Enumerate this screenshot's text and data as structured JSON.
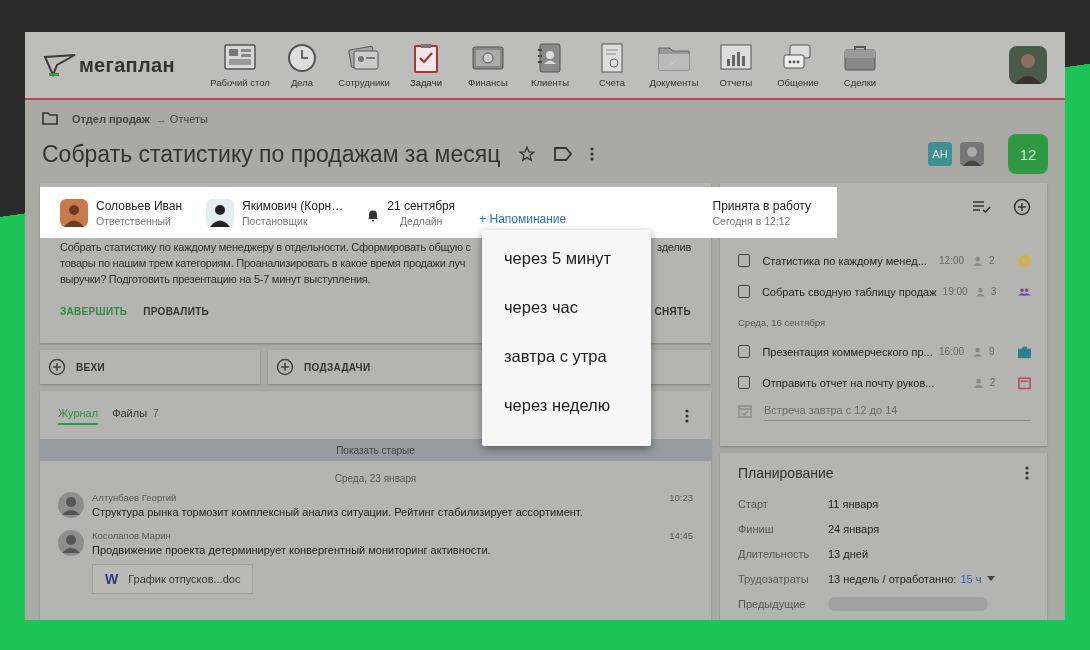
{
  "header": {
    "logo": "мегаплан",
    "nav": [
      {
        "label": "Рабочий стол",
        "selected": false
      },
      {
        "label": "Дела",
        "selected": false
      },
      {
        "label": "Сотрудники",
        "selected": false
      },
      {
        "label": "Задачи",
        "selected": true
      },
      {
        "label": "Финансы",
        "selected": false
      },
      {
        "label": "Клиенты",
        "selected": false
      },
      {
        "label": "Счета",
        "selected": false
      },
      {
        "label": "Документы",
        "selected": false
      },
      {
        "label": "Отчеты",
        "selected": false
      },
      {
        "label": "Общение",
        "selected": false
      },
      {
        "label": "Сделки",
        "selected": false
      }
    ]
  },
  "breadcrumb": {
    "section": "Отдел продаж",
    "current": "→ Отчеты"
  },
  "task": {
    "title": "Собрать статистику по продажам за месяц",
    "watchers_initials": "АН",
    "counter": "12",
    "participants": [
      {
        "name": "Соловьев Иван",
        "role": "Ответственный"
      },
      {
        "name": "Якимович (Корн…",
        "role": "Постановщик"
      }
    ],
    "deadline": {
      "date": "21 сентября",
      "label": "Дедлайн"
    },
    "reminder_link": "+ Напоминание",
    "status": {
      "text": "Принята в работу",
      "time": "Сегодня в 12:12"
    },
    "description_lines": [
      {
        "left": "Собрать статистику по каждому менеджеру в отдельности. Сформировать общую с",
        "right": "зделив"
      },
      {
        "left": "товары по нашим трем категориям. Проанализировать в какое время продажи луч"
      },
      {
        "left": "выручки? Подготовить презентацию на 5-7 минут выступления."
      }
    ],
    "actions": [
      {
        "label": "ЗАВЕРШИТЬ",
        "kind": "primary"
      },
      {
        "label": "ПРОВАЛИТЬ",
        "kind": "plain"
      }
    ],
    "right_action": "СНЯТЬ",
    "add_buttons": [
      "ВЕХИ",
      "ПОДЗАДАЧИ"
    ]
  },
  "reminder_menu": [
    "через 5 минут",
    "через час",
    "завтра с утра",
    "через неделю"
  ],
  "journal": {
    "tabs": [
      {
        "label": "Журнал",
        "selected": true
      },
      {
        "label": "Файлы",
        "count": "7",
        "selected": false
      }
    ],
    "show_older": "Показать старые",
    "date": "Среда, 23 января",
    "messages": [
      {
        "author": "Алтунбаев Георгий",
        "time": "10:23",
        "text": "Структура рынка тормозит комплексный анализ ситуации. Рейтинг стабилизирует ассортимент."
      },
      {
        "author": "Косолапов Марин",
        "time": "14:45",
        "text": "Продвижение проекта детерминирует конвергентный мониторинг активности.",
        "attachment": "График отпусков...doc",
        "attachment_icon": "W"
      }
    ]
  },
  "todo": {
    "groups": [
      {
        "items": [
          {
            "text": "Статистика по каждому менед...",
            "time": "12:00",
            "people": "2",
            "checked": false,
            "kind": "person",
            "color": "#d4b23a"
          },
          {
            "text": "Собрать сводную таблицу продаж",
            "time": "19:00",
            "people": "3",
            "checked": false,
            "kind": "group",
            "color": "#6e45a8"
          }
        ]
      },
      {
        "date": "Среда, 16 сентября",
        "items": [
          {
            "text": "Презентация коммерческого пр...",
            "time": "16:00",
            "people": "9",
            "checked": false,
            "kind": "briefcase",
            "color": "#2c7f8c"
          },
          {
            "text": "Отправить отчет на почту руков...",
            "people": "2",
            "checked": false,
            "kind": "calendar",
            "color": "#b84a58"
          }
        ]
      }
    ],
    "new_item": {
      "placeholder": "Встреча завтра с 12 до 14"
    }
  },
  "planning": {
    "title": "Планирование",
    "rows": [
      {
        "label": "Старт",
        "value": "11 января",
        "kind": "text"
      },
      {
        "label": "Финиш",
        "value": "24 января",
        "kind": "text"
      },
      {
        "label": "Длительность",
        "value": "13 дней",
        "kind": "text"
      },
      {
        "label": "Трудозатраты",
        "value": "13 недель / отработанно:",
        "link": "15 ч",
        "kind": "effort"
      },
      {
        "label": "Предыдущие",
        "kind": "pill"
      }
    ]
  }
}
